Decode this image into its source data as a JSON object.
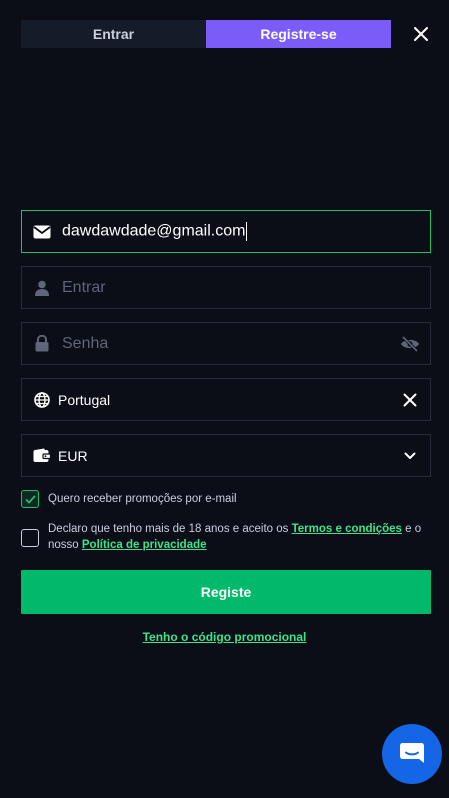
{
  "tabs": {
    "login_label": "Entrar",
    "register_label": "Registre-se"
  },
  "form": {
    "email_value": "dawdawdade@gmail.com",
    "login_placeholder": "Entrar",
    "password_placeholder": "Senha",
    "country_value": "Portugal",
    "currency_value": "EUR"
  },
  "consents": {
    "promo_text": "Quero receber promoções por e-mail",
    "promo_checked": true,
    "terms_prefix": "Declaro que tenho mais de 18 anos e aceito os",
    "terms_link": "Termos e condições",
    "terms_middle": "e o nosso",
    "privacy_link": "Política de privacidade",
    "terms_checked": false
  },
  "submit_label": "Registe",
  "promo_code_link": "Tenho o código promocional",
  "colors": {
    "background": "#0b0d17",
    "accent_purple": "#7c5cf9",
    "accent_green": "#00b96b",
    "link_green": "#3ee48d",
    "chat_blue": "#1466e6"
  },
  "icons": [
    "close-icon",
    "envelope-icon",
    "user-icon",
    "lock-icon",
    "eye-off-icon",
    "globe-icon",
    "clear-icon",
    "wallet-icon",
    "chevron-down-icon",
    "check-icon",
    "chat-icon"
  ]
}
